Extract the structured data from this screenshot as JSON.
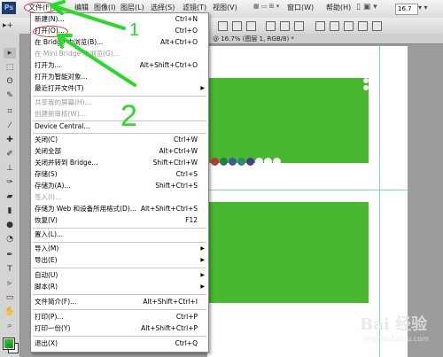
{
  "app": {
    "logo": "Ps"
  },
  "menubar": {
    "items": [
      "文件(F)",
      "编辑",
      "图像(I)",
      "图层(L)",
      "选择(S)",
      "滤镜(T)",
      "视图(V)",
      "窗口(W)",
      "帮助(H)"
    ],
    "zoom": "16.7"
  },
  "doc": {
    "title": "@ 16.7% (图层 1, RGB/8) *"
  },
  "file_menu": {
    "items": [
      {
        "label": "新建(N)...",
        "shortcut": "Ctrl+N"
      },
      {
        "label": "打开(O)...",
        "shortcut": "Ctrl+O"
      },
      {
        "label": "在 Bridge 中浏览(B)...",
        "shortcut": "Alt+Ctrl+O"
      },
      {
        "label": "在 Mini Bridge 中浏览(G)...",
        "shortcut": "",
        "disabled": true
      },
      {
        "label": "打开为...",
        "shortcut": "Alt+Shift+Ctrl+O"
      },
      {
        "label": "打开为智能对象...",
        "shortcut": ""
      },
      {
        "label": "最近打开文件(T)",
        "shortcut": "",
        "submenu": true
      },
      {
        "label": "共享我的屏幕(H)...",
        "shortcut": "",
        "disabled": true
      },
      {
        "label": "创建新审核(W)...",
        "shortcut": "",
        "disabled": true
      },
      {
        "label": "Device Central...",
        "shortcut": ""
      },
      {
        "label": "关闭(C)",
        "shortcut": "Ctrl+W"
      },
      {
        "label": "关闭全部",
        "shortcut": "Alt+Ctrl+W"
      },
      {
        "label": "关闭并转到 Bridge...",
        "shortcut": "Shift+Ctrl+W"
      },
      {
        "label": "存储(S)",
        "shortcut": "Ctrl+S"
      },
      {
        "label": "存储为(A)...",
        "shortcut": "Shift+Ctrl+S"
      },
      {
        "label": "签入(I)...",
        "shortcut": "",
        "disabled": true
      },
      {
        "label": "存储为 Web 和设备所用格式(D)...",
        "shortcut": "Alt+Shift+Ctrl+S"
      },
      {
        "label": "恢复(V)",
        "shortcut": "F12"
      },
      {
        "label": "置入(L)...",
        "shortcut": ""
      },
      {
        "label": "导入(M)",
        "shortcut": "",
        "submenu": true
      },
      {
        "label": "导出(E)",
        "shortcut": "",
        "submenu": true
      },
      {
        "label": "自动(U)",
        "shortcut": "",
        "submenu": true
      },
      {
        "label": "脚本(R)",
        "shortcut": "",
        "submenu": true
      },
      {
        "label": "文件简介(F)...",
        "shortcut": "Alt+Shift+Ctrl+I"
      },
      {
        "label": "打印(P)...",
        "shortcut": "Ctrl+P"
      },
      {
        "label": "打印一份(Y)",
        "shortcut": "Alt+Shift+Ctrl+P"
      },
      {
        "label": "退出(X)",
        "shortcut": "Ctrl+Q"
      }
    ]
  },
  "annotations": {
    "step1": "1",
    "step2": "2"
  },
  "watermark": {
    "main": "Bai 经验",
    "sub": "jingyan.baidu.com"
  },
  "colors": {
    "green": "#47b82f",
    "annotation": "#22dd22",
    "highlight": "#dd3333"
  }
}
